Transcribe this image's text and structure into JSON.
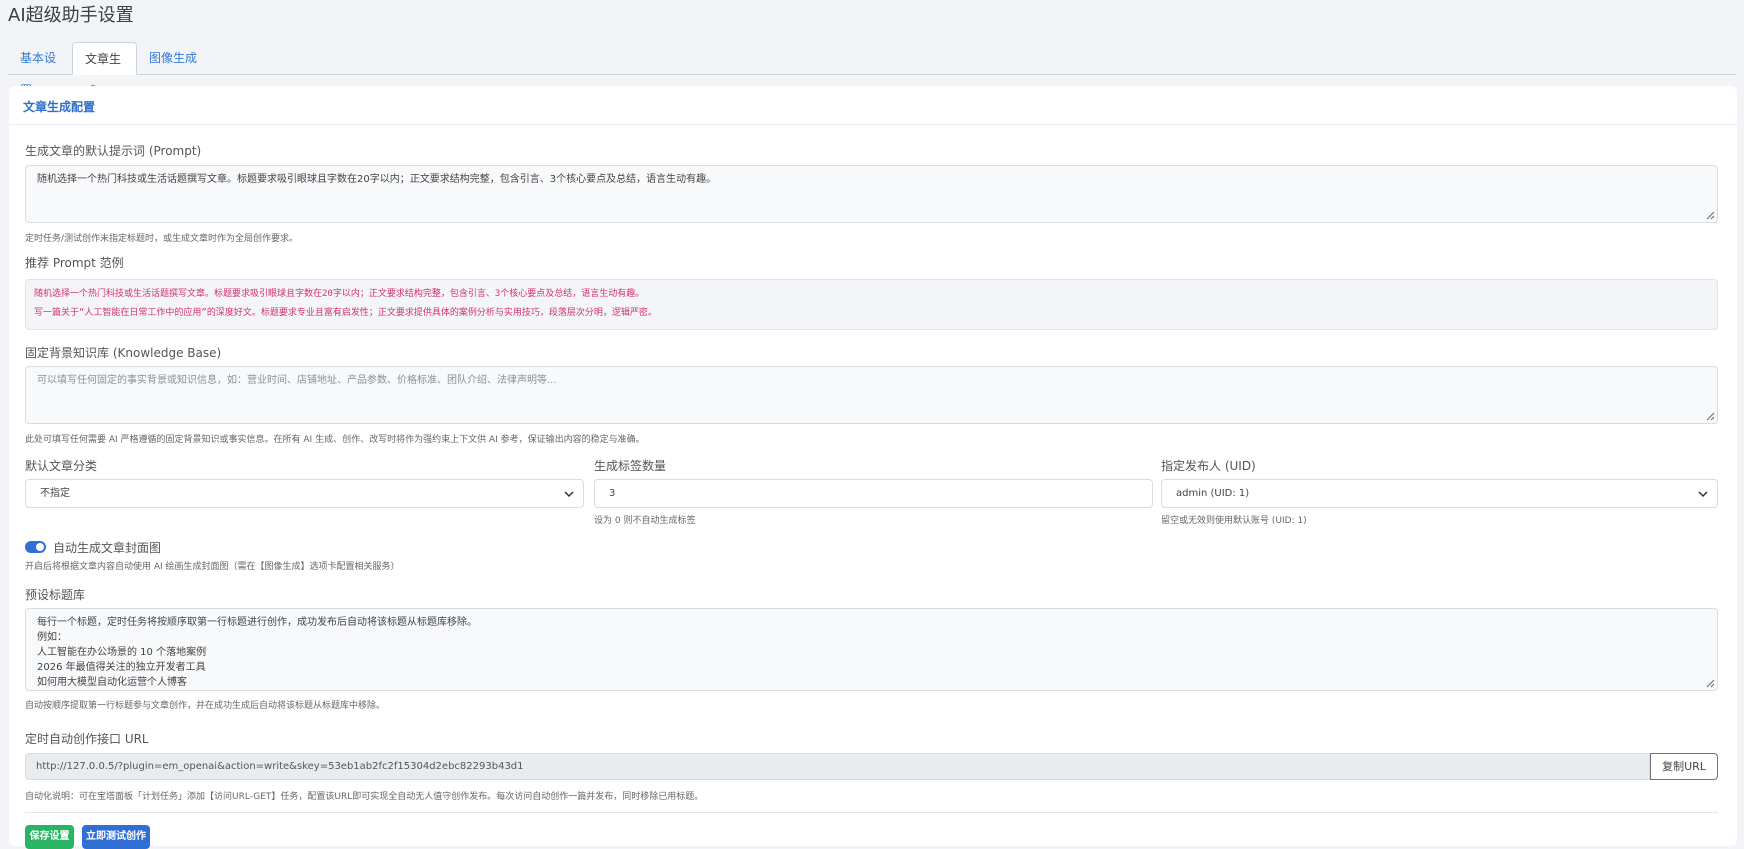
{
  "page": {
    "title": "AI超级助手设置"
  },
  "tabs": [
    {
      "label": "基本设置",
      "active": false
    },
    {
      "label": "文章生成",
      "active": true
    },
    {
      "label": "图像生成",
      "active": false
    }
  ],
  "card": {
    "title": "文章生成配置"
  },
  "prompt": {
    "label": "生成文章的默认提示词 (Prompt)",
    "value": "随机选择一个热门科技或生活话题撰写文章。标题要求吸引眼球且字数在20字以内；正文要求结构完整，包含引言、3个核心要点及总结，语言生动有趣。",
    "hint": "定时任务/测试创作未指定标题时，或生成文章时作为全局创作要求。"
  },
  "examples": {
    "label": "推荐 Prompt 范例",
    "items": [
      "随机选择一个热门科技或生活话题撰写文章。标题要求吸引眼球且字数在20字以内；正文要求结构完整，包含引言、3个核心要点及总结，语言生动有趣。",
      "写一篇关于“人工智能在日常工作中的应用”的深度好文。标题要求专业且富有启发性；正文要求提供具体的案例分析与实用技巧，段落层次分明，逻辑严密。"
    ]
  },
  "knowledge": {
    "label": "固定背景知识库 (Knowledge Base)",
    "placeholder": "可以填写任何固定的事实背景或知识信息，如：营业时间、店铺地址、产品参数、价格标准、团队介绍、法律声明等...",
    "hint": "此处可填写任何需要 AI 严格遵循的固定背景知识或事实信息。在所有 AI 生成、创作、改写时将作为强约束上下文供 AI 参考，保证输出内容的稳定与准确。"
  },
  "category": {
    "label": "默认文章分类",
    "value": "不指定"
  },
  "tags": {
    "label": "生成标签数量",
    "value": "3",
    "hint": "设为 0 则不自动生成标签"
  },
  "author": {
    "label": "指定发布人 (UID)",
    "value": "admin (UID: 1)",
    "hint": "留空或无效则使用默认账号 (UID: 1)"
  },
  "cover": {
    "label": "自动生成文章封面图",
    "enabled": true,
    "hint": "开启后将根据文章内容自动使用 AI 绘画生成封面图（需在【图像生成】选项卡配置相关服务）"
  },
  "titles": {
    "label": "预设标题库",
    "lines": [
      "每行一个标题，定时任务将按顺序取第一行标题进行创作，成功发布后自动将该标题从标题库移除。",
      "例如：",
      "人工智能在办公场景的 10 个落地案例",
      "2026 年最值得关注的独立开发者工具",
      "如何用大模型自动化运营个人博客"
    ],
    "hint": "自动按顺序提取第一行标题参与文章创作，并在成功生成后自动将该标题从标题库中移除。"
  },
  "cron": {
    "label": "定时自动创作接口 URL",
    "url": "http://127.0.0.5/?plugin=em_openai&action=write&skey=53eb1ab2fc2f15304d2ebc82293b43d1",
    "copy_label": "复制URL",
    "hint": "自动化说明：可在宝塔面板「计划任务」添加【访问URL-GET】任务，配置该URL即可实现全自动无人值守创作发布。每次访问自动创作一篇并发布，同时移除已用标题。"
  },
  "actions": {
    "save_label": "保存设置",
    "test_label": "立即测试创作"
  },
  "colors": {
    "accent": "#2f6fd6",
    "save": "#28b463",
    "code": "#d6336c"
  }
}
